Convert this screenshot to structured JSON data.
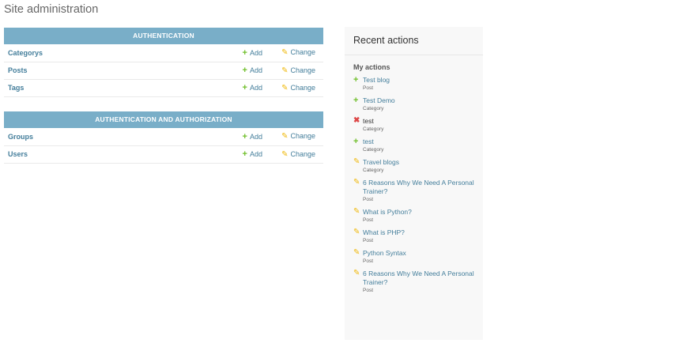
{
  "page_title": "Site administration",
  "modules": [
    {
      "caption": "Authentication",
      "rows": [
        {
          "name": "Categorys",
          "add": "Add",
          "change": "Change"
        },
        {
          "name": "Posts",
          "add": "Add",
          "change": "Change"
        },
        {
          "name": "Tags",
          "add": "Add",
          "change": "Change"
        }
      ]
    },
    {
      "caption": "Authentication and Authorization",
      "rows": [
        {
          "name": "Groups",
          "add": "Add",
          "change": "Change"
        },
        {
          "name": "Users",
          "add": "Add",
          "change": "Change"
        }
      ]
    }
  ],
  "recent": {
    "title": "Recent actions",
    "subtitle": "My actions",
    "items": [
      {
        "action": "add",
        "object": "Test blog",
        "type": "Post"
      },
      {
        "action": "add",
        "object": "Test Demo",
        "type": "Category"
      },
      {
        "action": "delete",
        "object": "test",
        "type": "Category"
      },
      {
        "action": "add",
        "object": "test",
        "type": "Category"
      },
      {
        "action": "change",
        "object": "Travel blogs",
        "type": "Category"
      },
      {
        "action": "change",
        "object": "6 Reasons Why We Need A Personal Trainer?",
        "type": "Post"
      },
      {
        "action": "change",
        "object": "What is Python?",
        "type": "Post"
      },
      {
        "action": "change",
        "object": "What is PHP?",
        "type": "Post"
      },
      {
        "action": "change",
        "object": "Python Syntax",
        "type": "Post"
      },
      {
        "action": "change",
        "object": "6 Reasons Why We Need A Personal Trainer?",
        "type": "Post"
      }
    ]
  },
  "icons": {
    "add": "plus-icon",
    "change": "pencil-icon",
    "delete": "cross-icon"
  },
  "colors": {
    "header": "#79aec8",
    "link": "#447e9b",
    "add": "#70bf2b",
    "change": "#efb80b",
    "delete": "#dd4646"
  }
}
